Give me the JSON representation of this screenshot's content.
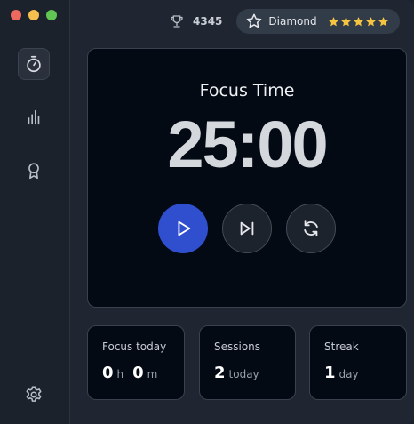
{
  "window": {
    "controls": [
      "close",
      "minimize",
      "maximize"
    ]
  },
  "sidebar": {
    "items": [
      {
        "name": "timer",
        "icon": "stopwatch-icon",
        "active": true
      },
      {
        "name": "stats",
        "icon": "bar-chart-icon",
        "active": false
      },
      {
        "name": "achievements",
        "icon": "award-ribbon-icon",
        "active": false
      }
    ],
    "footer": {
      "name": "settings",
      "icon": "gear-icon"
    }
  },
  "header": {
    "points_icon": "trophy-icon",
    "points": "4345",
    "rank_icon": "star-outline-icon",
    "rank": "Diamond",
    "rating": 5,
    "rating_color": "#f5c542"
  },
  "timer": {
    "label": "Focus Time",
    "value": "25:00",
    "controls": [
      {
        "name": "play",
        "icon": "play-icon"
      },
      {
        "name": "skip",
        "icon": "skip-next-icon"
      },
      {
        "name": "reset",
        "icon": "refresh-icon"
      }
    ]
  },
  "stats": {
    "focus_today": {
      "title": "Focus today",
      "hours": "0",
      "hours_unit": "h",
      "minutes": "0",
      "minutes_unit": "m"
    },
    "sessions": {
      "title": "Sessions",
      "value": "2",
      "unit": "today"
    },
    "streak": {
      "title": "Streak",
      "value": "1",
      "unit": "day"
    }
  },
  "colors": {
    "accent": "#2f4fcf",
    "background": "#1f2631",
    "card": "#040a14"
  }
}
